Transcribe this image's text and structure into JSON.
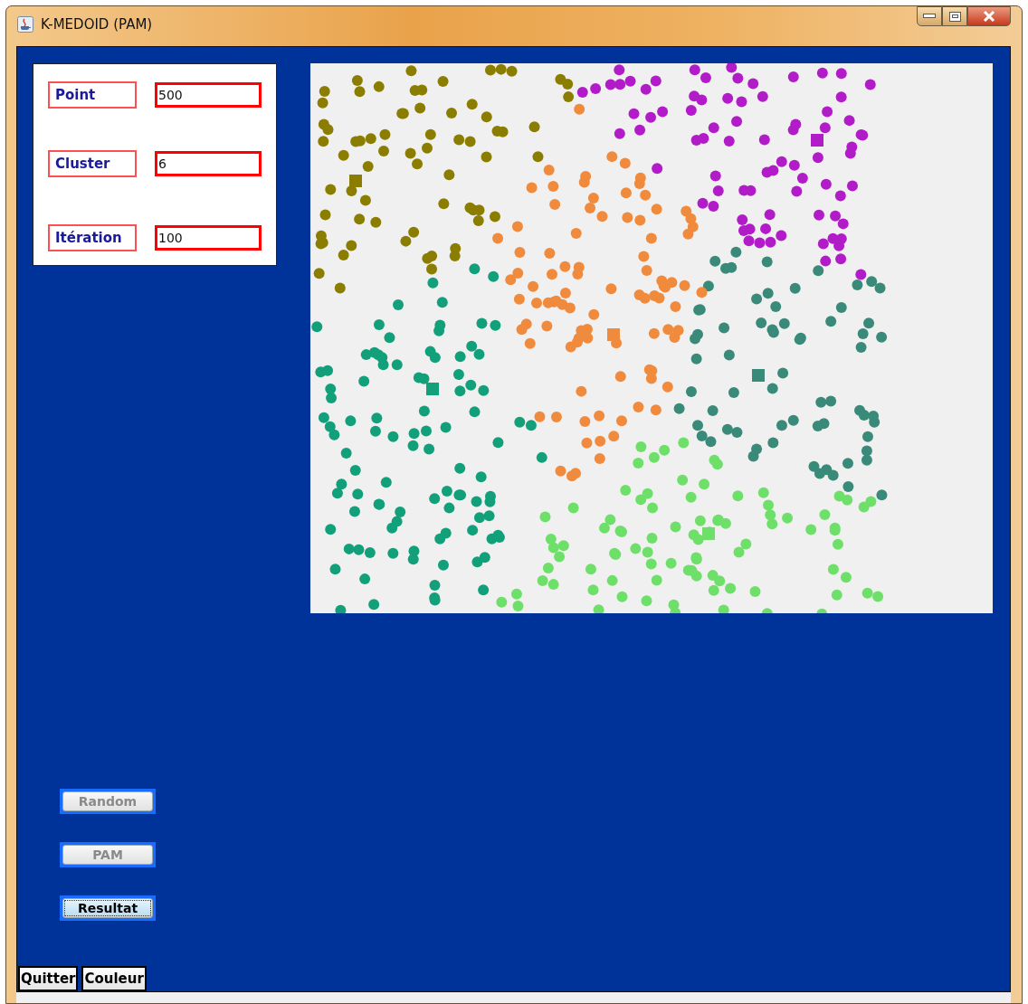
{
  "window": {
    "title": "K-MEDOID (PAM)"
  },
  "fields": [
    {
      "label": "Point",
      "value": "500"
    },
    {
      "label": "Cluster",
      "value": "6"
    },
    {
      "label": "Itération",
      "value": "100"
    }
  ],
  "actions": [
    {
      "label": "Random",
      "disabled": true,
      "focused": false
    },
    {
      "label": "PAM",
      "disabled": true,
      "focused": false
    },
    {
      "label": "Resultat",
      "disabled": false,
      "focused": true
    }
  ],
  "bottom_buttons": [
    {
      "label": "Quitter"
    },
    {
      "label": "Couleur"
    }
  ]
}
